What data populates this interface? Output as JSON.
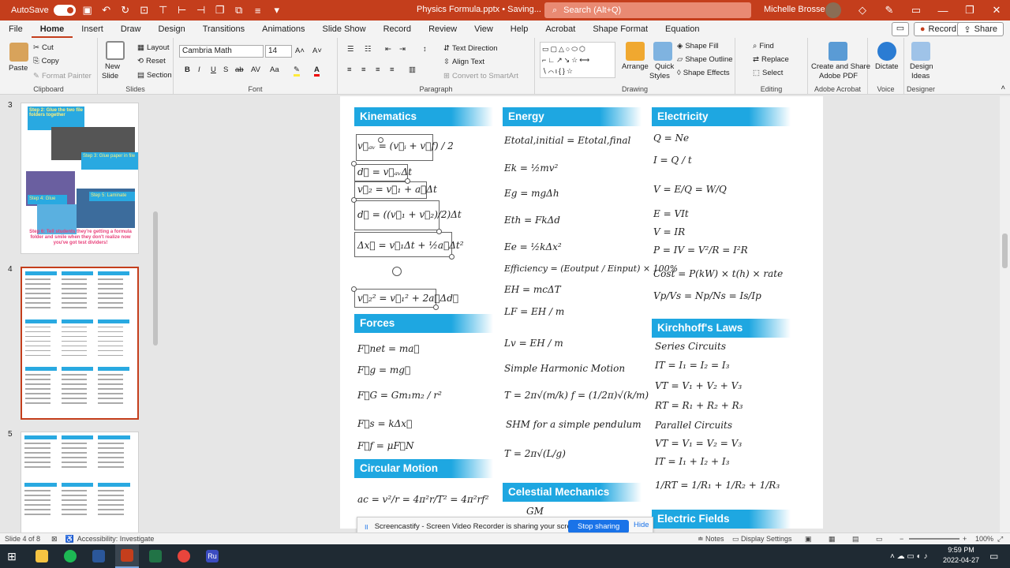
{
  "titlebar": {
    "autosave": "AutoSave",
    "autosave_state": "Off",
    "doc_title": "Physics Formula.pptx • Saving...",
    "search_placeholder": "Search (Alt+Q)",
    "user": "Michelle Brosseau"
  },
  "menu": [
    "File",
    "Home",
    "Insert",
    "Draw",
    "Design",
    "Transitions",
    "Animations",
    "Slide Show",
    "Record",
    "Review",
    "View",
    "Help",
    "Acrobat",
    "Shape Format",
    "Equation"
  ],
  "menu_active": "Home",
  "record_label": "Record",
  "share_label": "Share",
  "ribbon": {
    "clipboard": {
      "label": "Clipboard",
      "paste": "Paste",
      "cut": "Cut",
      "copy": "Copy",
      "format_painter": "Format Painter"
    },
    "slides": {
      "label": "Slides",
      "new_slide": "New",
      "new_slide2": "Slide",
      "layout": "Layout",
      "reset": "Reset",
      "section": "Section"
    },
    "font": {
      "label": "Font",
      "font_name": "Cambria Math",
      "font_size": "14",
      "case": "Aa"
    },
    "paragraph": {
      "label": "Paragraph",
      "text_direction": "Text Direction",
      "align_text": "Align Text",
      "smartart": "Convert to SmartArt"
    },
    "drawing": {
      "label": "Drawing",
      "arrange": "Arrange",
      "quick_styles": "Quick",
      "quick_styles2": "Styles",
      "shape_fill": "Shape Fill",
      "shape_outline": "Shape Outline",
      "shape_effects": "Shape Effects"
    },
    "editing": {
      "label": "Editing",
      "find": "Find",
      "replace": "Replace",
      "select": "Select"
    },
    "acrobat": {
      "label": "Adobe Acrobat",
      "create": "Create and Share",
      "create2": "Adobe PDF"
    },
    "voice": {
      "label": "Voice",
      "dictate": "Dictate"
    },
    "designer": {
      "label": "Designer",
      "ideas": "Design",
      "ideas2": "Ideas"
    }
  },
  "thumbs": {
    "n3": "3",
    "n4": "4",
    "n5": "5",
    "t3": {
      "step2": "Step 2: Glue the two file folders together",
      "step3": "Step 3: Glue paper in file",
      "step4": "Step 4: Glue",
      "step5": "Step 5: Laminate",
      "step6": "Step 6: Tell students they're getting a formula folder and smile when they don't realize now you've got test dividers!"
    }
  },
  "slide": {
    "kinematics": {
      "title": "Kinematics",
      "f1": "v⃗ₐᵥ = (v⃗ᵢ + v⃗f) / 2",
      "f2": "d⃗ = v⃗ₐᵥΔt",
      "f3": "v⃗₂ = v⃗₁ + a⃗Δt",
      "f4": "d⃗ = ((v⃗₁ + v⃗₂)/2)Δt",
      "f5": "Δx⃗ = v⃗₁Δt + ½a⃗Δt²",
      "f6": "v⃗₂² = v⃗₁² + 2a⃗Δd⃗"
    },
    "forces": {
      "title": "Forces",
      "f1": "F⃗net = ma⃗",
      "f2": "F⃗g = mg⃗",
      "f3": "F⃗G = Gm₁m₂ / r²",
      "f4": "F⃗s = kΔx⃗",
      "f5": "F⃗f = μF⃗N"
    },
    "circular": {
      "title": "Circular Motion",
      "f1": "ac = v²/r = 4π²r/T² = 4π²rf²"
    },
    "energy": {
      "title": "Energy",
      "f1": "Etotal,initial = Etotal,final",
      "f2": "Ek = ½mv²",
      "f3": "Eg = mgΔh",
      "f4": "Eth = FkΔd",
      "f5": "Ee = ½kΔx²",
      "f6": "Efficiency = (Eoutput / Einput) × 100%",
      "f7": "EH = mcΔT",
      "f8": "LF = EH / m",
      "f9": "Lv = EH / m",
      "f10": "Simple Harmonic Motion",
      "f11": "T = 2π√(m/k)     f = (1/2π)√(k/m)",
      "f12": "SHM for a simple pendulum",
      "f13": "T = 2π√(L/g)"
    },
    "celestial": {
      "title": "Celestial Mechanics",
      "f1": "GM"
    },
    "electricity": {
      "title": "Electricity",
      "f1": "Q = Ne",
      "f2": "I = Q / t",
      "f3": "V = E/Q = W/Q",
      "f4": "E = VIt",
      "f5": "V = IR",
      "f6": "P = IV = V²/R = I²R",
      "f7": "Cost = P(kW) × t(h) × rate",
      "f8": "Vp/Vs = Np/Ns = Is/Ip"
    },
    "kirchhoff": {
      "title": "Kirchhoff's Laws",
      "series": "Series Circuits",
      "s1": "IT = I₁ = I₂ = I₃",
      "s2": "VT = V₁ + V₂ + V₃",
      "s3": "RT = R₁ + R₂ + R₃",
      "parallel": "Parallel Circuits",
      "p1": "VT = V₁ = V₂ = V₃",
      "p2": "IT = I₁ + I₂ + I₃",
      "p3": "1/RT = 1/R₁ + 1/R₂ + 1/R₃"
    },
    "efields": {
      "title": "Electric Fields"
    }
  },
  "screencastify": {
    "message": "Screencastify - Screen Video Recorder is sharing your screen.",
    "stop": "Stop sharing",
    "hide": "Hide"
  },
  "status": {
    "slide": "Slide 4 of 8",
    "accessibility": "Accessibility: Investigate",
    "notes": "Notes",
    "display": "Display Settings",
    "zoom": "100%"
  },
  "taskbar": {
    "time": "9:59 PM",
    "date": "2022-04-27",
    "ru": "Ru"
  },
  "colors": {
    "accent": "#c43e1c",
    "header_blue": "#1ea7e1"
  }
}
